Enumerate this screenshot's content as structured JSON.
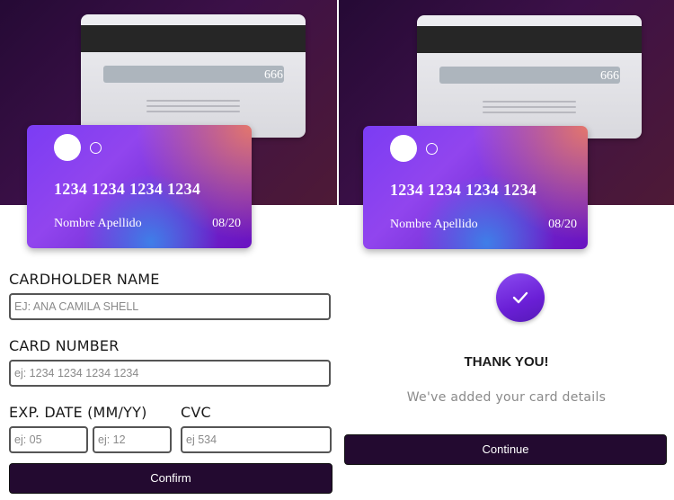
{
  "colors": {
    "hero_bg": "#3c1048",
    "button_bg": "#230a30",
    "card_gradient_start": "#7b3cf4",
    "card_gradient_end": "#6a12c0",
    "check_circle": "#6a1fd6"
  },
  "card": {
    "back_cvc": "666",
    "number": "1234 1234 1234 1234",
    "holder": "Nombre Apellido",
    "expiry": "08/20"
  },
  "form": {
    "cardholder_label": "CARDHOLDER NAME",
    "cardholder_placeholder": "EJ: ANA CAMILA SHELL",
    "card_number_label": "CARD NUMBER",
    "card_number_placeholder": "ej: 1234 1234 1234 1234",
    "exp_label": "EXP. DATE (MM/YY)",
    "exp_month_placeholder": "ej: 05",
    "exp_year_placeholder": "ej: 12",
    "cvc_label": "CVC",
    "cvc_placeholder": "ej 534",
    "confirm_label": "Confirm"
  },
  "success": {
    "check_icon": "checkmark-icon",
    "title": "THANK YOU!",
    "message": "We've added your card details",
    "continue_label": "Continue"
  }
}
